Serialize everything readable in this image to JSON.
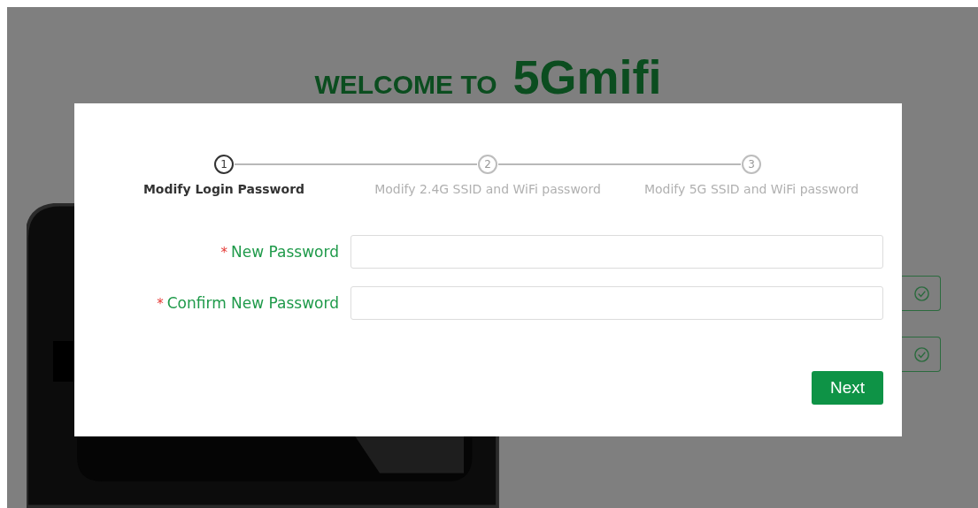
{
  "heading": {
    "prefix": "WELCOME TO",
    "brand": "5Gmifi"
  },
  "steps": [
    {
      "number": "1",
      "label": "Modify Login Password",
      "selected": true
    },
    {
      "number": "2",
      "label": "Modify 2.4G SSID and WiFi password",
      "selected": false
    },
    {
      "number": "3",
      "label": "Modify 5G SSID and WiFi password",
      "selected": false
    }
  ],
  "fields": [
    {
      "label": "New Password",
      "required": true,
      "required_mark": "*"
    },
    {
      "label": "Confirm New Password",
      "required": true,
      "required_mark": "*"
    }
  ],
  "next_button": "Next"
}
